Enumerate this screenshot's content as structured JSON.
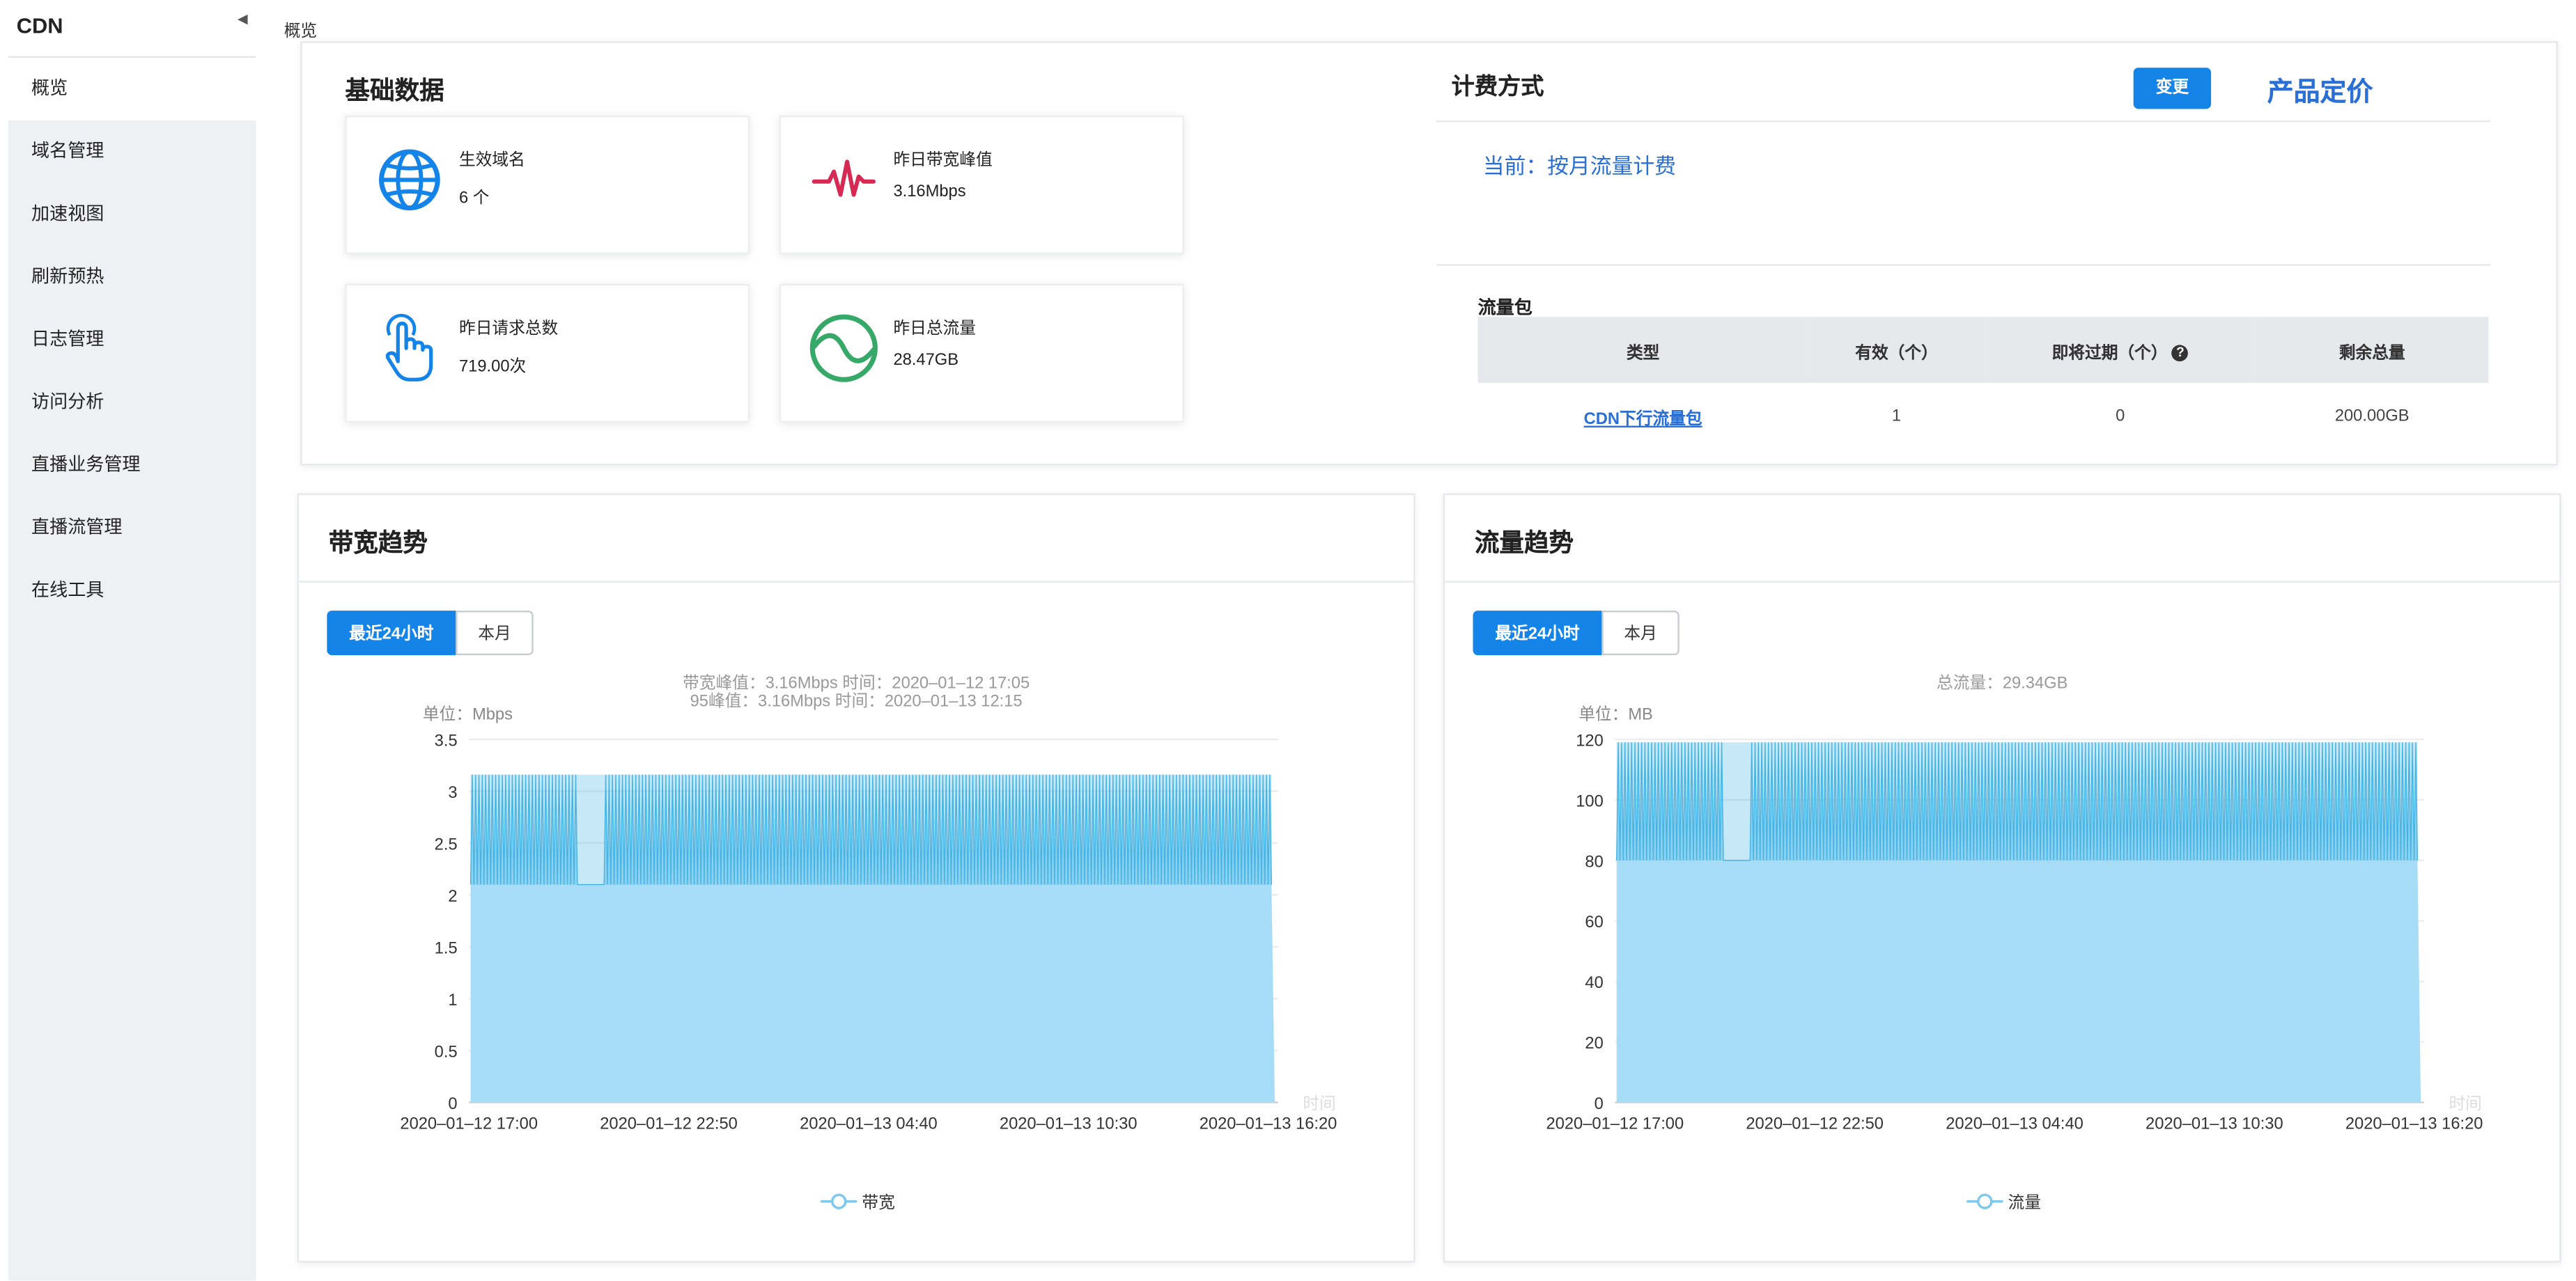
{
  "sidebar": {
    "title": "CDN",
    "items": [
      {
        "label": "概览",
        "active": true
      },
      {
        "label": "域名管理",
        "active": false
      },
      {
        "label": "加速视图",
        "active": false
      },
      {
        "label": "刷新预热",
        "active": false
      },
      {
        "label": "日志管理",
        "active": false
      },
      {
        "label": "访问分析",
        "active": false
      },
      {
        "label": "直播业务管理",
        "active": false
      },
      {
        "label": "直播流管理",
        "active": false
      },
      {
        "label": "在线工具",
        "active": false
      }
    ]
  },
  "breadcrumb": "概览",
  "basic": {
    "title": "基础数据",
    "stats": [
      {
        "label": "生效域名",
        "value": "6 个",
        "icon": "globe-icon"
      },
      {
        "label": "昨日带宽峰值",
        "value": "3.16Mbps",
        "icon": "pulse-icon"
      },
      {
        "label": "昨日请求总数",
        "value": "719.00次",
        "icon": "tap-hand-icon"
      },
      {
        "label": "昨日总流量",
        "value": "28.47GB",
        "icon": "wave-circle-icon"
      }
    ]
  },
  "billing": {
    "title": "计费方式",
    "change_label": "变更",
    "pricing_link": "产品定价",
    "current": "当前：按月流量计费",
    "package_title": "流量包",
    "columns": [
      "类型",
      "有效（个）",
      "即将过期（个）",
      "剩余总量"
    ],
    "rows": [
      [
        "CDN下行流量包",
        "1",
        "0",
        "200.00GB"
      ]
    ]
  },
  "colors": {
    "primary": "#1584e8",
    "area_fill": "#a6dcf5",
    "area_line": "#3bb1e3"
  },
  "bandwidth": {
    "title": "带宽趋势",
    "tabs": [
      "最近24小时",
      "本月"
    ],
    "note1": "带宽峰值：3.16Mbps 时间：2020–01–12 17:05",
    "note2": "95峰值：3.16Mbps 时间：2020–01–13 12:15",
    "unit": "单位：Mbps",
    "legend": "带宽"
  },
  "traffic": {
    "title": "流量趋势",
    "tabs": [
      "最近24小时",
      "本月"
    ],
    "note1": "总流量：29.34GB",
    "unit": "单位：MB",
    "legend": "流量"
  },
  "chart_data": [
    {
      "type": "area",
      "title": "带宽趋势",
      "ylabel": "单位：Mbps",
      "xlabel": "时间",
      "ylim": [
        0,
        3.5
      ],
      "yticks": [
        "0",
        "0.5",
        "1",
        "1.5",
        "2",
        "2.5",
        "3",
        "3.5"
      ],
      "xticks": [
        "2020–01–12 17:00",
        "2020–01–12 22:50",
        "2020–01–13 04:40",
        "2020–01–13 10:30",
        "2020–01–13 16:20"
      ],
      "series": [
        {
          "name": "带宽",
          "pattern": "oscillating",
          "low": 2.1,
          "high": 3.16,
          "dip_at_fraction": 0.146
        }
      ],
      "grid": true,
      "legend": "bottom-center"
    },
    {
      "type": "area",
      "title": "流量趋势",
      "ylabel": "单位：MB",
      "xlabel": "时间",
      "ylim": [
        0,
        120
      ],
      "yticks": [
        "0",
        "20",
        "40",
        "60",
        "80",
        "100",
        "120"
      ],
      "xticks": [
        "2020–01–12 17:00",
        "2020–01–12 22:50",
        "2020–01–13 04:40",
        "2020–01–13 10:30",
        "2020–01–13 16:20"
      ],
      "series": [
        {
          "name": "流量",
          "pattern": "oscillating",
          "low": 80,
          "high": 119,
          "dip_at_fraction": 0.146
        }
      ],
      "grid": true,
      "legend": "bottom-center"
    }
  ]
}
